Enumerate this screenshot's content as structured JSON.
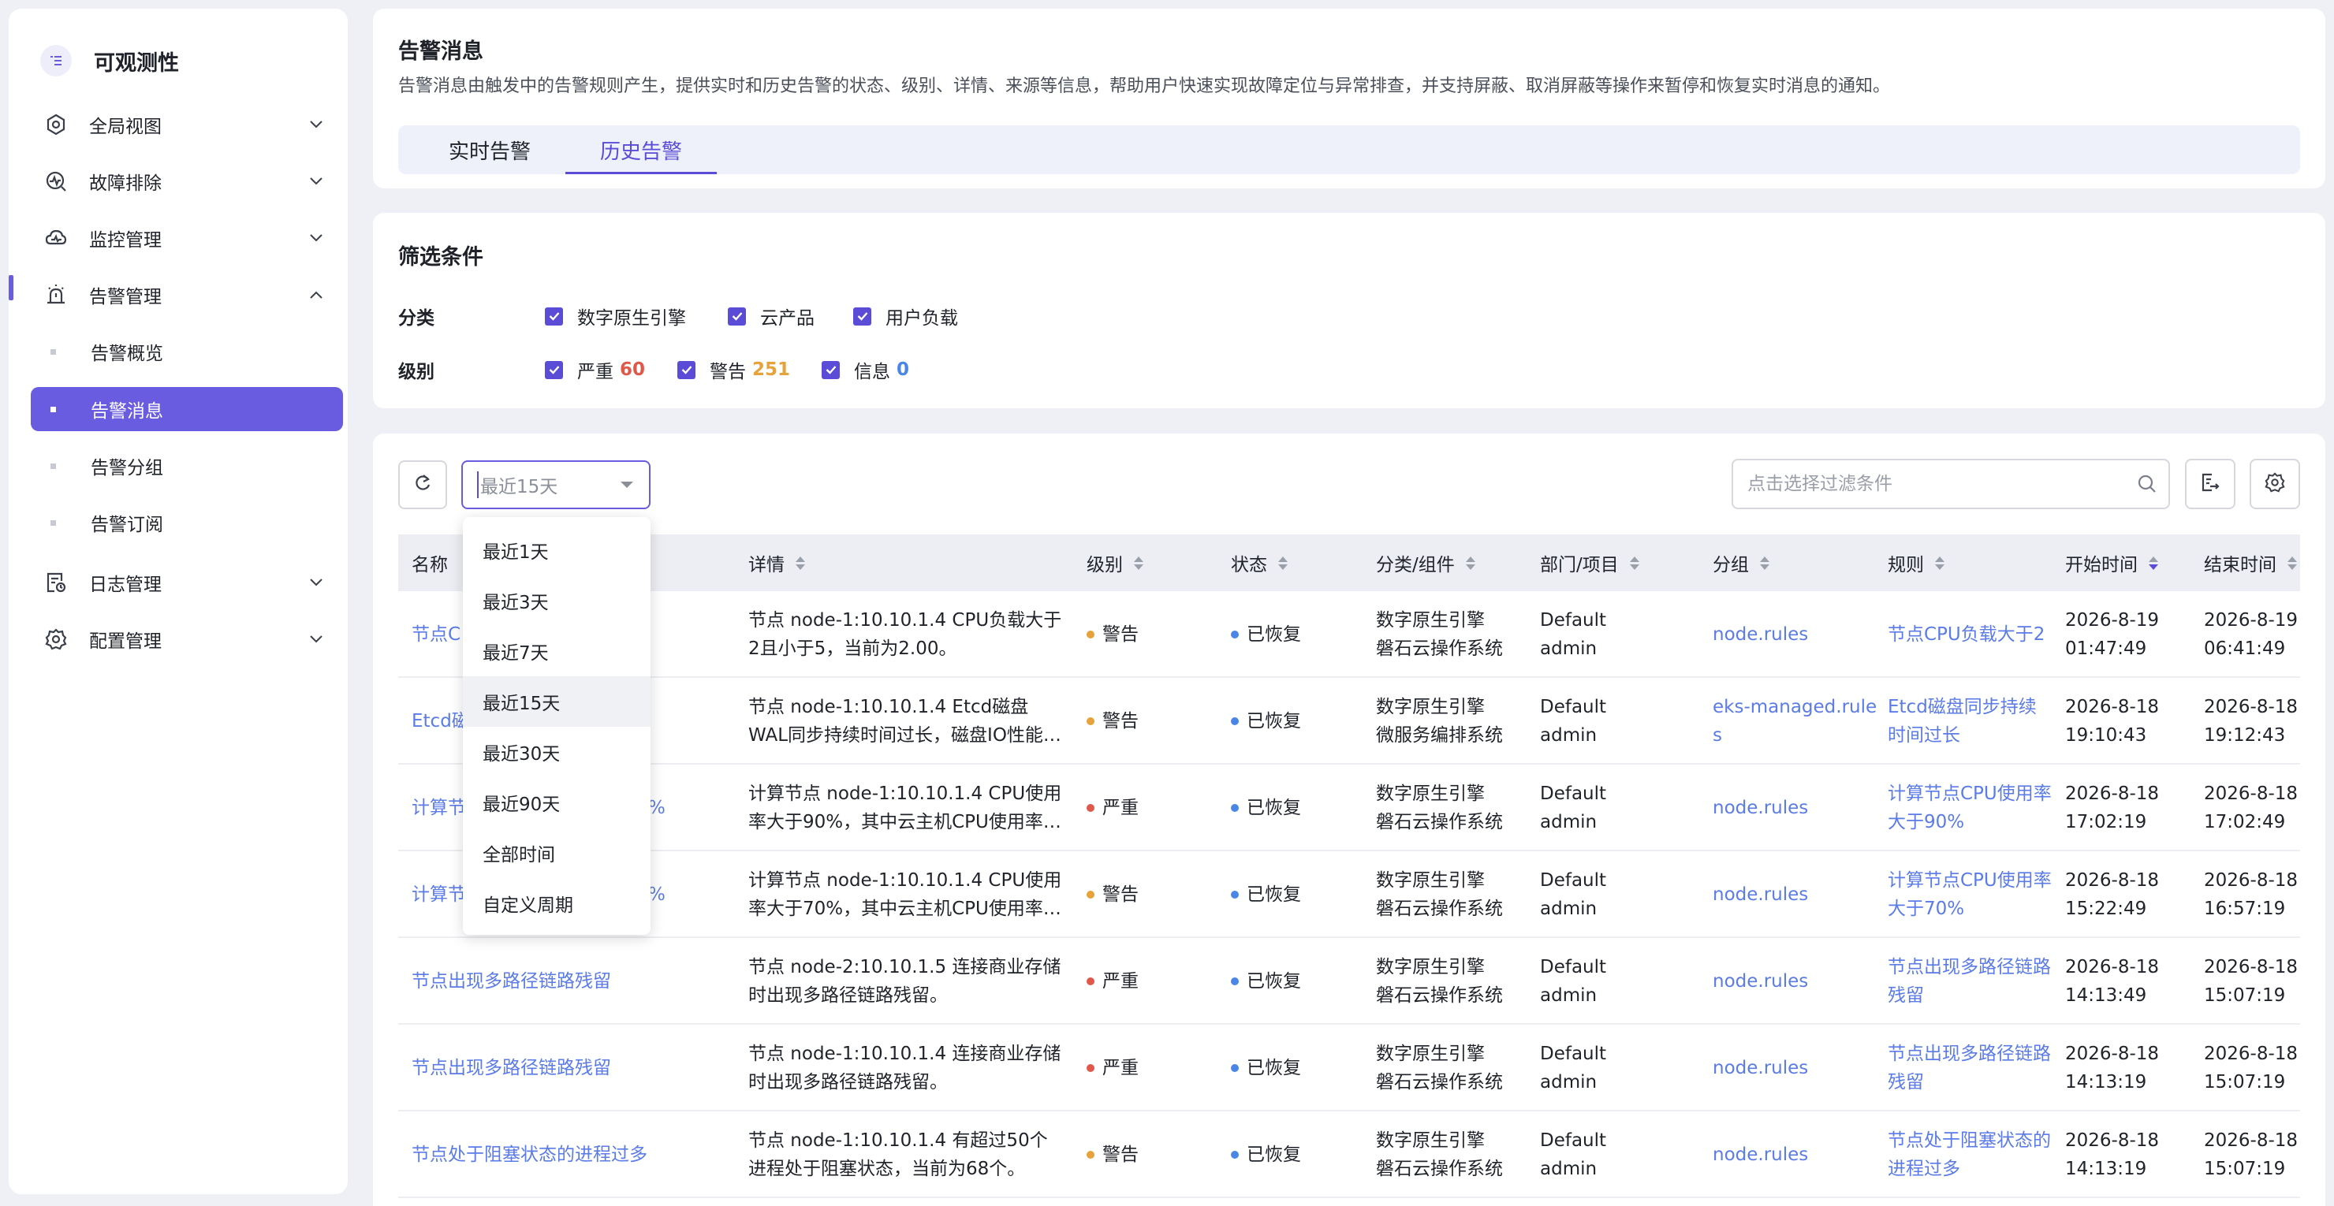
{
  "sidebar": {
    "brand": "可观测性",
    "items": [
      {
        "label": "全局视图",
        "icon": "dashboard-icon",
        "expanded": false
      },
      {
        "label": "故障排除",
        "icon": "troubleshoot-icon",
        "expanded": false
      },
      {
        "label": "监控管理",
        "icon": "monitor-icon",
        "expanded": false
      },
      {
        "label": "告警管理",
        "icon": "alarm-icon",
        "expanded": true
      },
      {
        "label": "日志管理",
        "icon": "log-icon",
        "expanded": false
      },
      {
        "label": "配置管理",
        "icon": "gear-icon",
        "expanded": false
      }
    ],
    "alert_sub": [
      "告警概览",
      "告警消息",
      "告警分组",
      "告警订阅"
    ],
    "active_sub": "告警消息"
  },
  "header": {
    "title": "告警消息",
    "description": "告警消息由触发中的告警规则产生，提供实时和历史告警的状态、级别、详情、来源等信息，帮助用户快速实现故障定位与异常排查，并支持屏蔽、取消屏蔽等操作来暂停和恢复实时消息的通知。",
    "tabs": [
      "实时告警",
      "历史告警"
    ],
    "active_tab": "历史告警"
  },
  "filters": {
    "title": "筛选条件",
    "category_label": "分类",
    "categories": [
      "数字原生引擎",
      "云产品",
      "用户负载"
    ],
    "level_label": "级别",
    "levels": [
      {
        "label": "严重",
        "count": "60",
        "color": "#e0584a"
      },
      {
        "label": "警告",
        "count": "251",
        "color": "#e8a23a"
      },
      {
        "label": "信息",
        "count": "0",
        "color": "#4a86e8"
      }
    ]
  },
  "toolbar": {
    "time_value": "最近15天",
    "search_placeholder": "点击选择过滤条件"
  },
  "time_options": [
    "最近1天",
    "最近3天",
    "最近7天",
    "最近15天",
    "最近30天",
    "最近90天",
    "全部时间",
    "自定义周期"
  ],
  "table": {
    "columns": [
      "名称",
      "详情",
      "级别",
      "状态",
      "分类/组件",
      "部门/项目",
      "分组",
      "规则",
      "开始时间",
      "结束时间"
    ],
    "rows": [
      {
        "name": "节点C",
        "detail": "节点 node-1:10.10.1.4 CPU负载大于2且小于5，当前为2.00。",
        "level": "警告",
        "level_color": "#e8a23a",
        "status": "已恢复",
        "cat1": "数字原生引擎",
        "cat2": "磐石云操作系统",
        "dept": "Default",
        "proj": "admin",
        "group": "node.rules",
        "rule": "节点CPU负载大于2",
        "start_date": "2026-8-19",
        "start_time": "01:47:49",
        "end_date": "2026-8-19",
        "end_time": "06:41:49"
      },
      {
        "name": "Etcd磁",
        "detail": "节点 node-1:10.10.1.4 Etcd磁盘WAL同步持续时间过长，磁盘IO性能不足，可能导致集群异常",
        "level": "警告",
        "level_color": "#e8a23a",
        "status": "已恢复",
        "cat1": "数字原生引擎",
        "cat2": "微服务编排系统",
        "dept": "Default",
        "proj": "admin",
        "group": "eks-managed.rules",
        "rule": "Etcd磁盘同步持续时间过长",
        "start_date": "2026-8-18",
        "start_time": "19:10:43",
        "end_date": "2026-8-18",
        "end_time": "19:12:43"
      },
      {
        "name": "计算节",
        "name_tail": "%",
        "detail": "计算节点 node-1:10.10.1.4 CPU使用率大于90%，其中云主机CPU使用率较高",
        "level": "严重",
        "level_color": "#e0584a",
        "status": "已恢复",
        "cat1": "数字原生引擎",
        "cat2": "磐石云操作系统",
        "dept": "Default",
        "proj": "admin",
        "group": "node.rules",
        "rule": "计算节点CPU使用率大于90%",
        "start_date": "2026-8-18",
        "start_time": "17:02:19",
        "end_date": "2026-8-18",
        "end_time": "17:02:49"
      },
      {
        "name": "计算节",
        "name_tail": "%",
        "detail": "计算节点 node-1:10.10.1.4 CPU使用率大于70%，其中云主机CPU使用率较高",
        "level": "警告",
        "level_color": "#e8a23a",
        "status": "已恢复",
        "cat1": "数字原生引擎",
        "cat2": "磐石云操作系统",
        "dept": "Default",
        "proj": "admin",
        "group": "node.rules",
        "rule": "计算节点CPU使用率大于70%",
        "start_date": "2026-8-18",
        "start_time": "15:22:49",
        "end_date": "2026-8-18",
        "end_time": "16:57:19"
      },
      {
        "name": "节点出现多路径链路残留",
        "detail": "节点 node-2:10.10.1.5 连接商业存储时出现多路径链路残留。",
        "level": "严重",
        "level_color": "#e0584a",
        "status": "已恢复",
        "cat1": "数字原生引擎",
        "cat2": "磐石云操作系统",
        "dept": "Default",
        "proj": "admin",
        "group": "node.rules",
        "rule": "节点出现多路径链路残留",
        "start_date": "2026-8-18",
        "start_time": "14:13:49",
        "end_date": "2026-8-18",
        "end_time": "15:07:19"
      },
      {
        "name": "节点出现多路径链路残留",
        "detail": "节点 node-1:10.10.1.4 连接商业存储时出现多路径链路残留。",
        "level": "严重",
        "level_color": "#e0584a",
        "status": "已恢复",
        "cat1": "数字原生引擎",
        "cat2": "磐石云操作系统",
        "dept": "Default",
        "proj": "admin",
        "group": "node.rules",
        "rule": "节点出现多路径链路残留",
        "start_date": "2026-8-18",
        "start_time": "14:13:19",
        "end_date": "2026-8-18",
        "end_time": "15:07:19"
      },
      {
        "name": "节点处于阻塞状态的进程过多",
        "detail": "节点 node-1:10.10.1.4 有超过50个进程处于阻塞状态，当前为68个。",
        "level": "警告",
        "level_color": "#e8a23a",
        "status": "已恢复",
        "cat1": "数字原生引擎",
        "cat2": "磐石云操作系统",
        "dept": "Default",
        "proj": "admin",
        "group": "node.rules",
        "rule": "节点处于阻塞状态的进程过多",
        "start_date": "2026-8-18",
        "start_time": "14:13:19",
        "end_date": "2026-8-18",
        "end_time": "15:07:19"
      }
    ]
  },
  "colors": {
    "accent": "#6a5ce0",
    "link": "#5b7be8",
    "recovered": "#4a86e8"
  }
}
